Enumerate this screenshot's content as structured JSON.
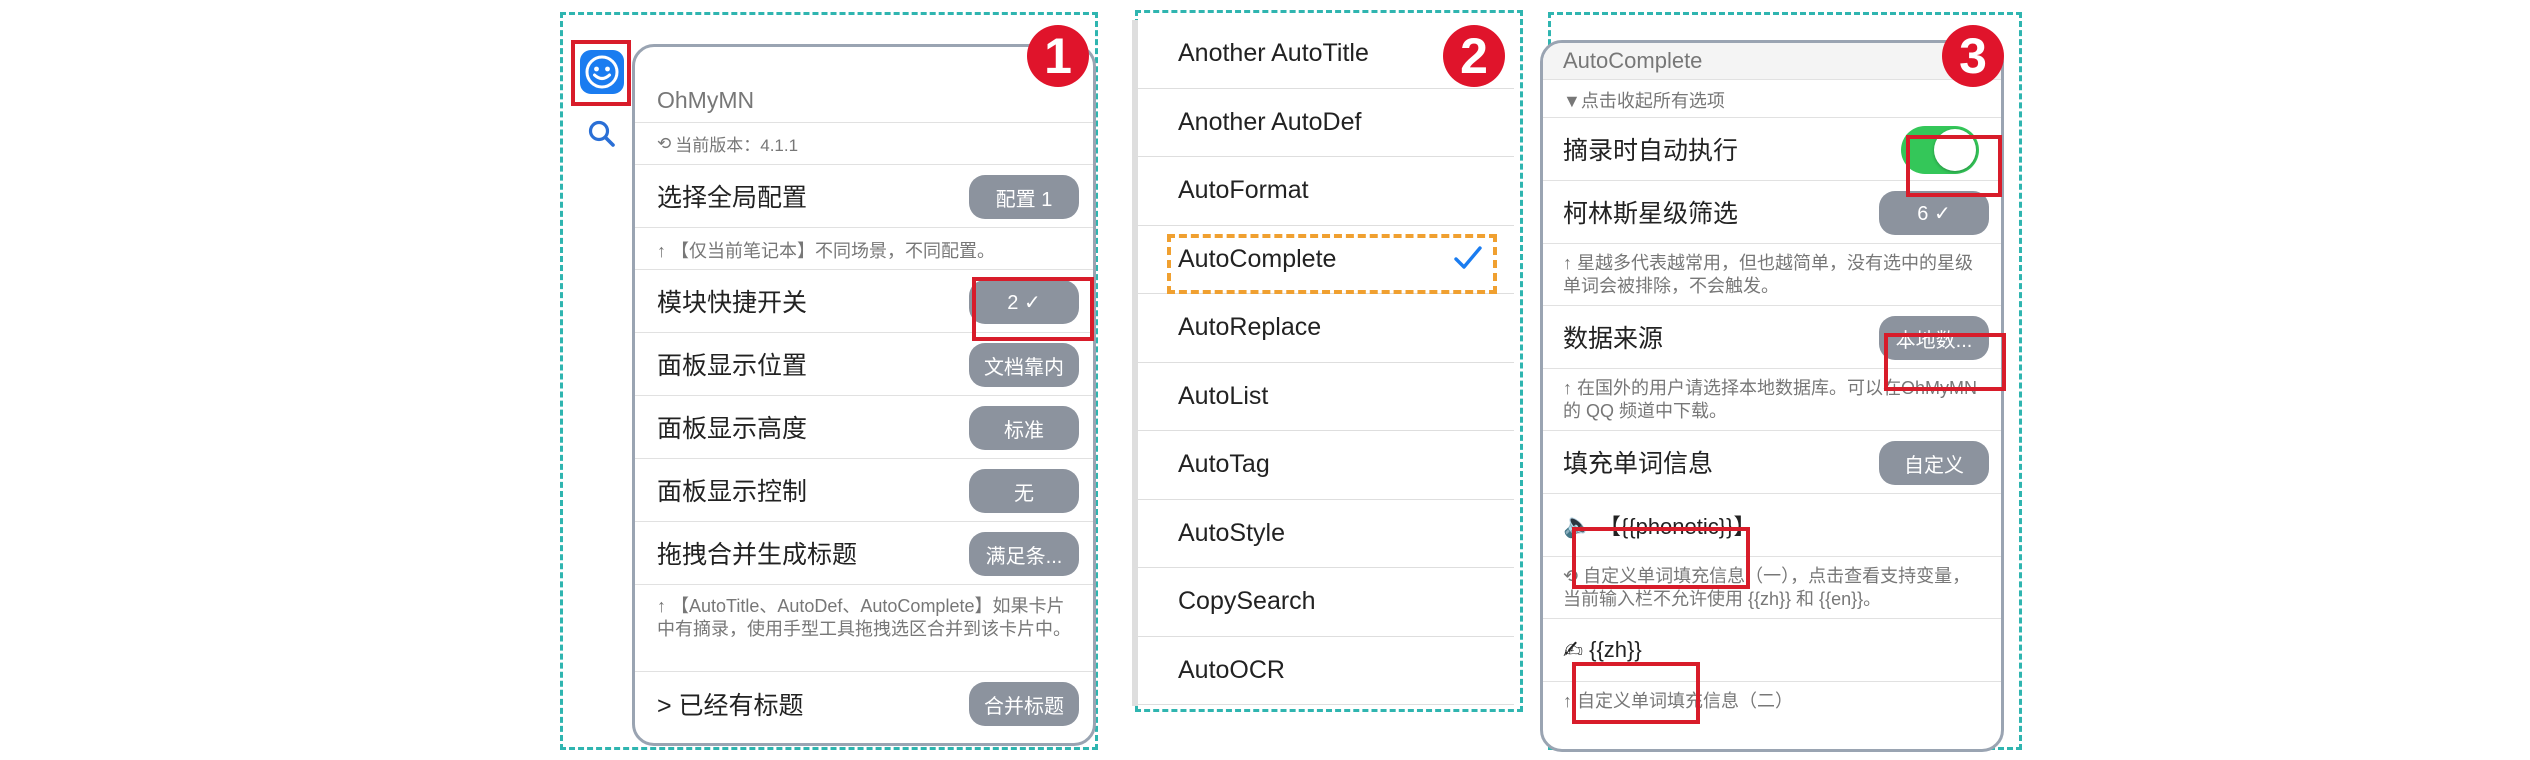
{
  "badges": [
    "1",
    "2",
    "3"
  ],
  "panel1": {
    "app_icon": "smiley-logo-icon",
    "search_icon": "search-icon",
    "title": "OhMyMN",
    "version": "当前版本：4.1.1",
    "version_icon": "refresh-icon",
    "rows": [
      {
        "label": "选择全局配置",
        "value": "配置 1"
      },
      {
        "label": "模块快捷开关",
        "value": "2 ✓"
      },
      {
        "label": "面板显示位置",
        "value": "文档靠内"
      },
      {
        "label": "面板显示高度",
        "value": "标准"
      },
      {
        "label": "面板显示控制",
        "value": "无"
      },
      {
        "label": "拖拽合并生成标题",
        "value": "满足条..."
      },
      {
        "label": "> 已经有标题",
        "value": "合并标题"
      }
    ],
    "note_scene": "↑ 【仅当前笔记本】不同场景，不同配置。",
    "note_merge": "↑ 【AutoTitle、AutoDef、AutoComplete】如果卡片中有摘录，使用手型工具拖拽选区合并到该卡片中。"
  },
  "panel2": {
    "items": [
      "Another AutoTitle",
      "Another AutoDef",
      "AutoFormat",
      "AutoComplete",
      "AutoReplace",
      "AutoList",
      "AutoTag",
      "AutoStyle",
      "CopySearch",
      "AutoOCR"
    ],
    "selected": "AutoComplete",
    "check_icon": "checkmark-icon"
  },
  "panel3": {
    "title": "AutoComplete",
    "collapse": "▼点击收起所有选项",
    "row_auto_exec": "摘录时自动执行",
    "toggle_on": true,
    "row_collins": "柯林斯星级筛选",
    "collins_value": "6 ✓",
    "note_collins": "↑ 星越多代表越常用，但也越简单，没有选中的星级单词会被排除，不会触发。",
    "row_source": "数据来源",
    "source_value": "本地数...",
    "note_source": "↑ 在国外的用户请选择本地数据库。可以在OhMyMN 的 QQ 频道中下载。",
    "row_fill": "填充单词信息",
    "fill_value": "自定义",
    "field_phonetic_icon": "speaker-icon",
    "field_phonetic": "【{{phonetic}}】",
    "note_custom1": "自定义单词填充信息（一），点击查看支持变量，当前输入栏不允许使用 {{zh}} 和 {{en}}。",
    "note_custom1_icon": "refresh-icon",
    "field_zh_icon": "writing-hand-icon",
    "field_zh": "{{zh}}",
    "note_custom2": "↑ 自定义单词填充信息（二）"
  },
  "colors": {
    "accent": "#2fb5b0",
    "badge": "#e0142b",
    "highlight": "#d81c2a",
    "pill": "#8c939e",
    "toggle": "#34c759",
    "check": "#1a7cf0",
    "selected_border": "#f0a030"
  }
}
